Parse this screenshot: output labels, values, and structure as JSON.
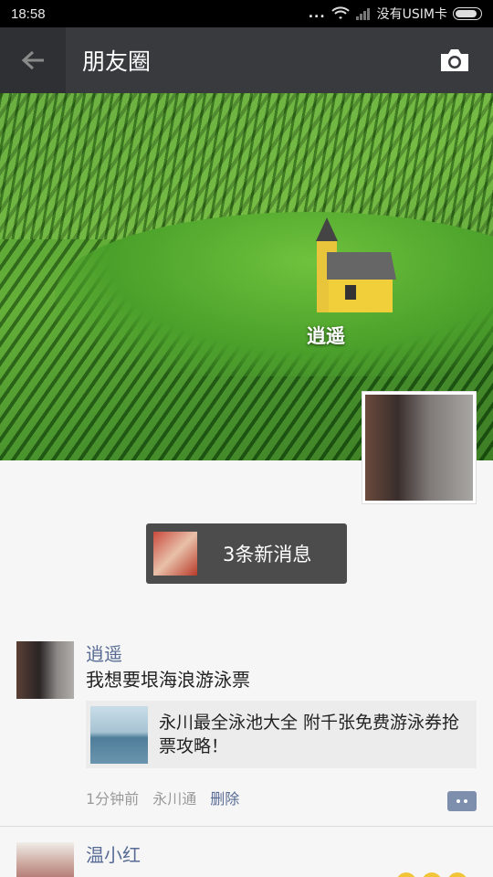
{
  "status_bar": {
    "time": "18:58",
    "dots": "...",
    "carrier": "没有USIM卡"
  },
  "header": {
    "title": "朋友圈",
    "back_icon": "arrow-left-icon",
    "camera_icon": "camera-icon"
  },
  "cover": {
    "name": "逍遥"
  },
  "new_messages": {
    "label": "3条新消息"
  },
  "posts": [
    {
      "user": "逍遥",
      "text": "我想要垠海浪游泳票",
      "link_title": "永川最全泳池大全 附千张免费游泳券抢票攻略！",
      "time": "1分钟前",
      "source": "永川通",
      "delete_label": "删除"
    },
    {
      "user": "温小红"
    }
  ],
  "colors": {
    "header_bg": "#393a3e",
    "username": "#576b95",
    "new_msg_bg": "#4c4c4c"
  }
}
